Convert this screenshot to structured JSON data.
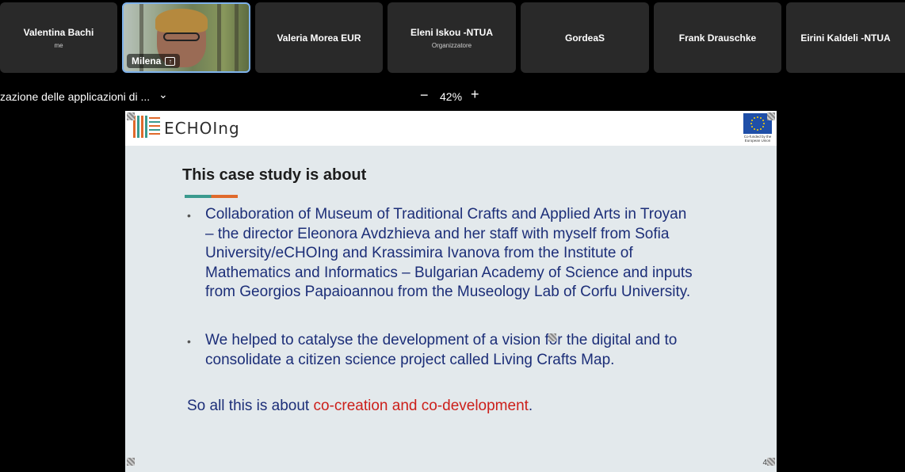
{
  "participants": [
    {
      "name": "Valentina Bachi",
      "sub": "me"
    },
    {
      "name": "Milena",
      "sub": ""
    },
    {
      "name": "Valeria Morea EUR",
      "sub": ""
    },
    {
      "name": "Eleni Iskou -NTUA",
      "sub": "Organizzatore"
    },
    {
      "name": "GordeaS",
      "sub": ""
    },
    {
      "name": "Frank Drauschke",
      "sub": ""
    },
    {
      "name": "Eirini Kaldeli -NTUA",
      "sub": ""
    }
  ],
  "toolbar": {
    "doc_title": "zazione delle applicazioni di ...",
    "zoom": "42%"
  },
  "slide": {
    "logo_text": "ECHOIng",
    "eu_caption": "Co-funded by the European Union",
    "title": "This case study is about",
    "bullets": [
      {
        "lines": [
          "Collaboration of Museum of Traditional Crafts and Applied Arts in Troyan",
          "– the director Eleonora Avdzhieva and her staff with myself from Sofia",
          "University/eCHOIng and Krassimira Ivanova from the Institute of",
          "Mathematics and Informatics – Bulgarian Academy of Science and inputs",
          "from Georgios Papaioannou from the Museology Lab of Corfu University."
        ]
      },
      {
        "lines": [
          "We helped to catalyse the development of a vision for the digital and to",
          "consolidate a citizen science project called Living Crafts Map."
        ]
      }
    ],
    "conclusion_pre": "So all this is about ",
    "conclusion_highlight": "co-creation and co-development",
    "conclusion_post": ".",
    "page_number": "4"
  }
}
